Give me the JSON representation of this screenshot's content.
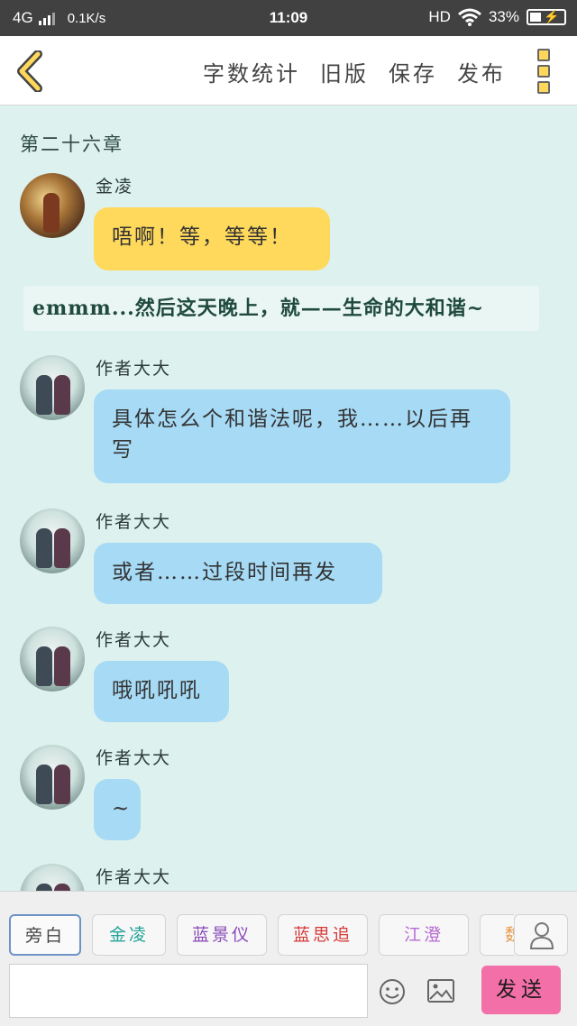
{
  "status_bar": {
    "network": "4G",
    "speed": "0.1K/s",
    "time": "11:09",
    "hd": "HD",
    "battery": "33%"
  },
  "header": {
    "actions": [
      "字数统计",
      "旧版",
      "保存",
      "发布"
    ]
  },
  "chapter_title": "第二十六章",
  "messages": [
    {
      "sender": "金凌",
      "text": "唔啊！等，等等！",
      "avatar": "jin-ling-avatar",
      "bubble_color": "#ffd95c"
    },
    {
      "sender": "作者大大",
      "text": "具体怎么个和谐法呢，我……以后再写",
      "avatar": "author-avatar",
      "bubble_color": "#a6daf5"
    },
    {
      "sender": "作者大大",
      "text": "或者……过段时间再发",
      "avatar": "author-avatar",
      "bubble_color": "#a6daf5"
    },
    {
      "sender": "作者大大",
      "text": "哦吼吼吼",
      "avatar": "author-avatar",
      "bubble_color": "#a6daf5"
    },
    {
      "sender": "作者大大",
      "text": "~",
      "avatar": "author-avatar",
      "bubble_color": "#a6daf5"
    },
    {
      "sender": "作者大大",
      "avatar": "author-avatar"
    }
  ],
  "narration": "emmm...然后这天晚上，就——生命的大和谐~",
  "roles": [
    {
      "label": "旁白",
      "color": "#444444",
      "selected": true
    },
    {
      "label": "金凌",
      "color": "#22a39a"
    },
    {
      "label": "蓝景仪",
      "color": "#8a4ab8"
    },
    {
      "label": "蓝思追",
      "color": "#d63a3a"
    },
    {
      "label": "江澄",
      "color": "#b66bd2"
    },
    {
      "label": "魏无",
      "color": "#e59a4a"
    }
  ],
  "composer": {
    "send_label": "发送",
    "send_color": "#f26fa7",
    "icons": [
      "emoji-icon",
      "image-icon",
      "person-icon"
    ]
  }
}
